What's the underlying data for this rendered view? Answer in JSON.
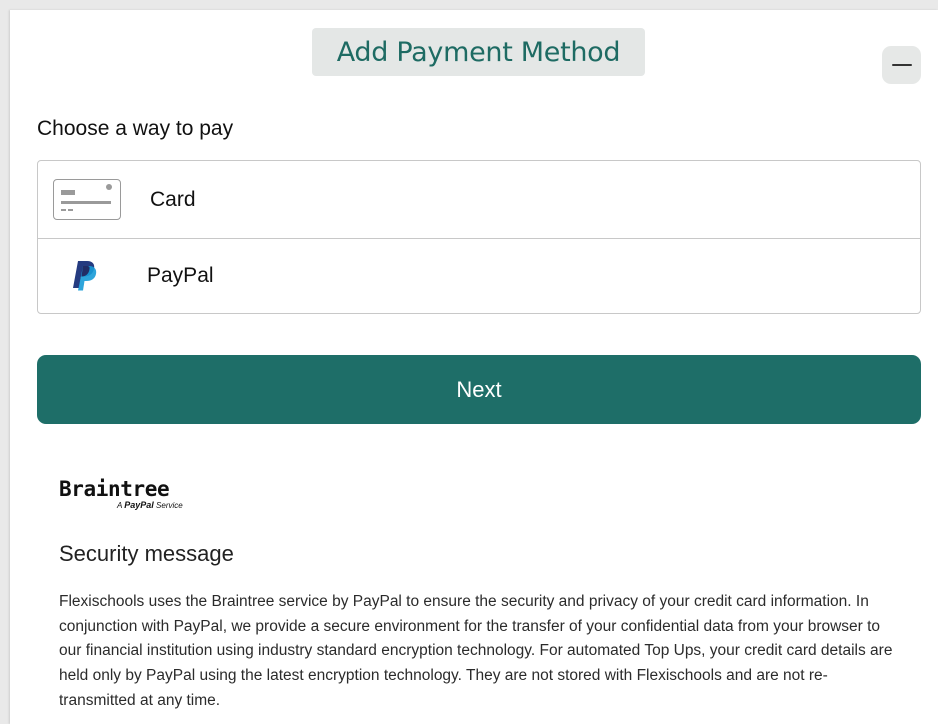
{
  "dialog": {
    "title": "Add Payment Method",
    "minimize_icon": "minus-icon"
  },
  "payment": {
    "prompt": "Choose a way to pay",
    "options": [
      {
        "label": "Card",
        "icon": "credit-card-icon"
      },
      {
        "label": "PayPal",
        "icon": "paypal-logo-icon"
      }
    ],
    "next_label": "Next"
  },
  "braintree": {
    "logo_word": "Braintree",
    "tagline_prefix": "A",
    "tagline_brand": "PayPal",
    "tagline_suffix": "Service"
  },
  "security": {
    "title": "Security message",
    "text": "Flexischools uses the Braintree service by PayPal to ensure the security and privacy of your credit card information. In conjunction with PayPal, we provide a secure environment for the transfer of your confidential data from your browser to our financial institution using industry standard encryption technology. For automated Top Ups, your credit card details are held only by PayPal using the latest encryption technology. They are not stored with Flexischools and are not re-transmitted at any time."
  },
  "colors": {
    "accent": "#1e6e68",
    "title_text": "#1e6b63",
    "title_bg": "#e4e7e6",
    "paypal_dark": "#253b80",
    "paypal_light": "#179bd7"
  }
}
